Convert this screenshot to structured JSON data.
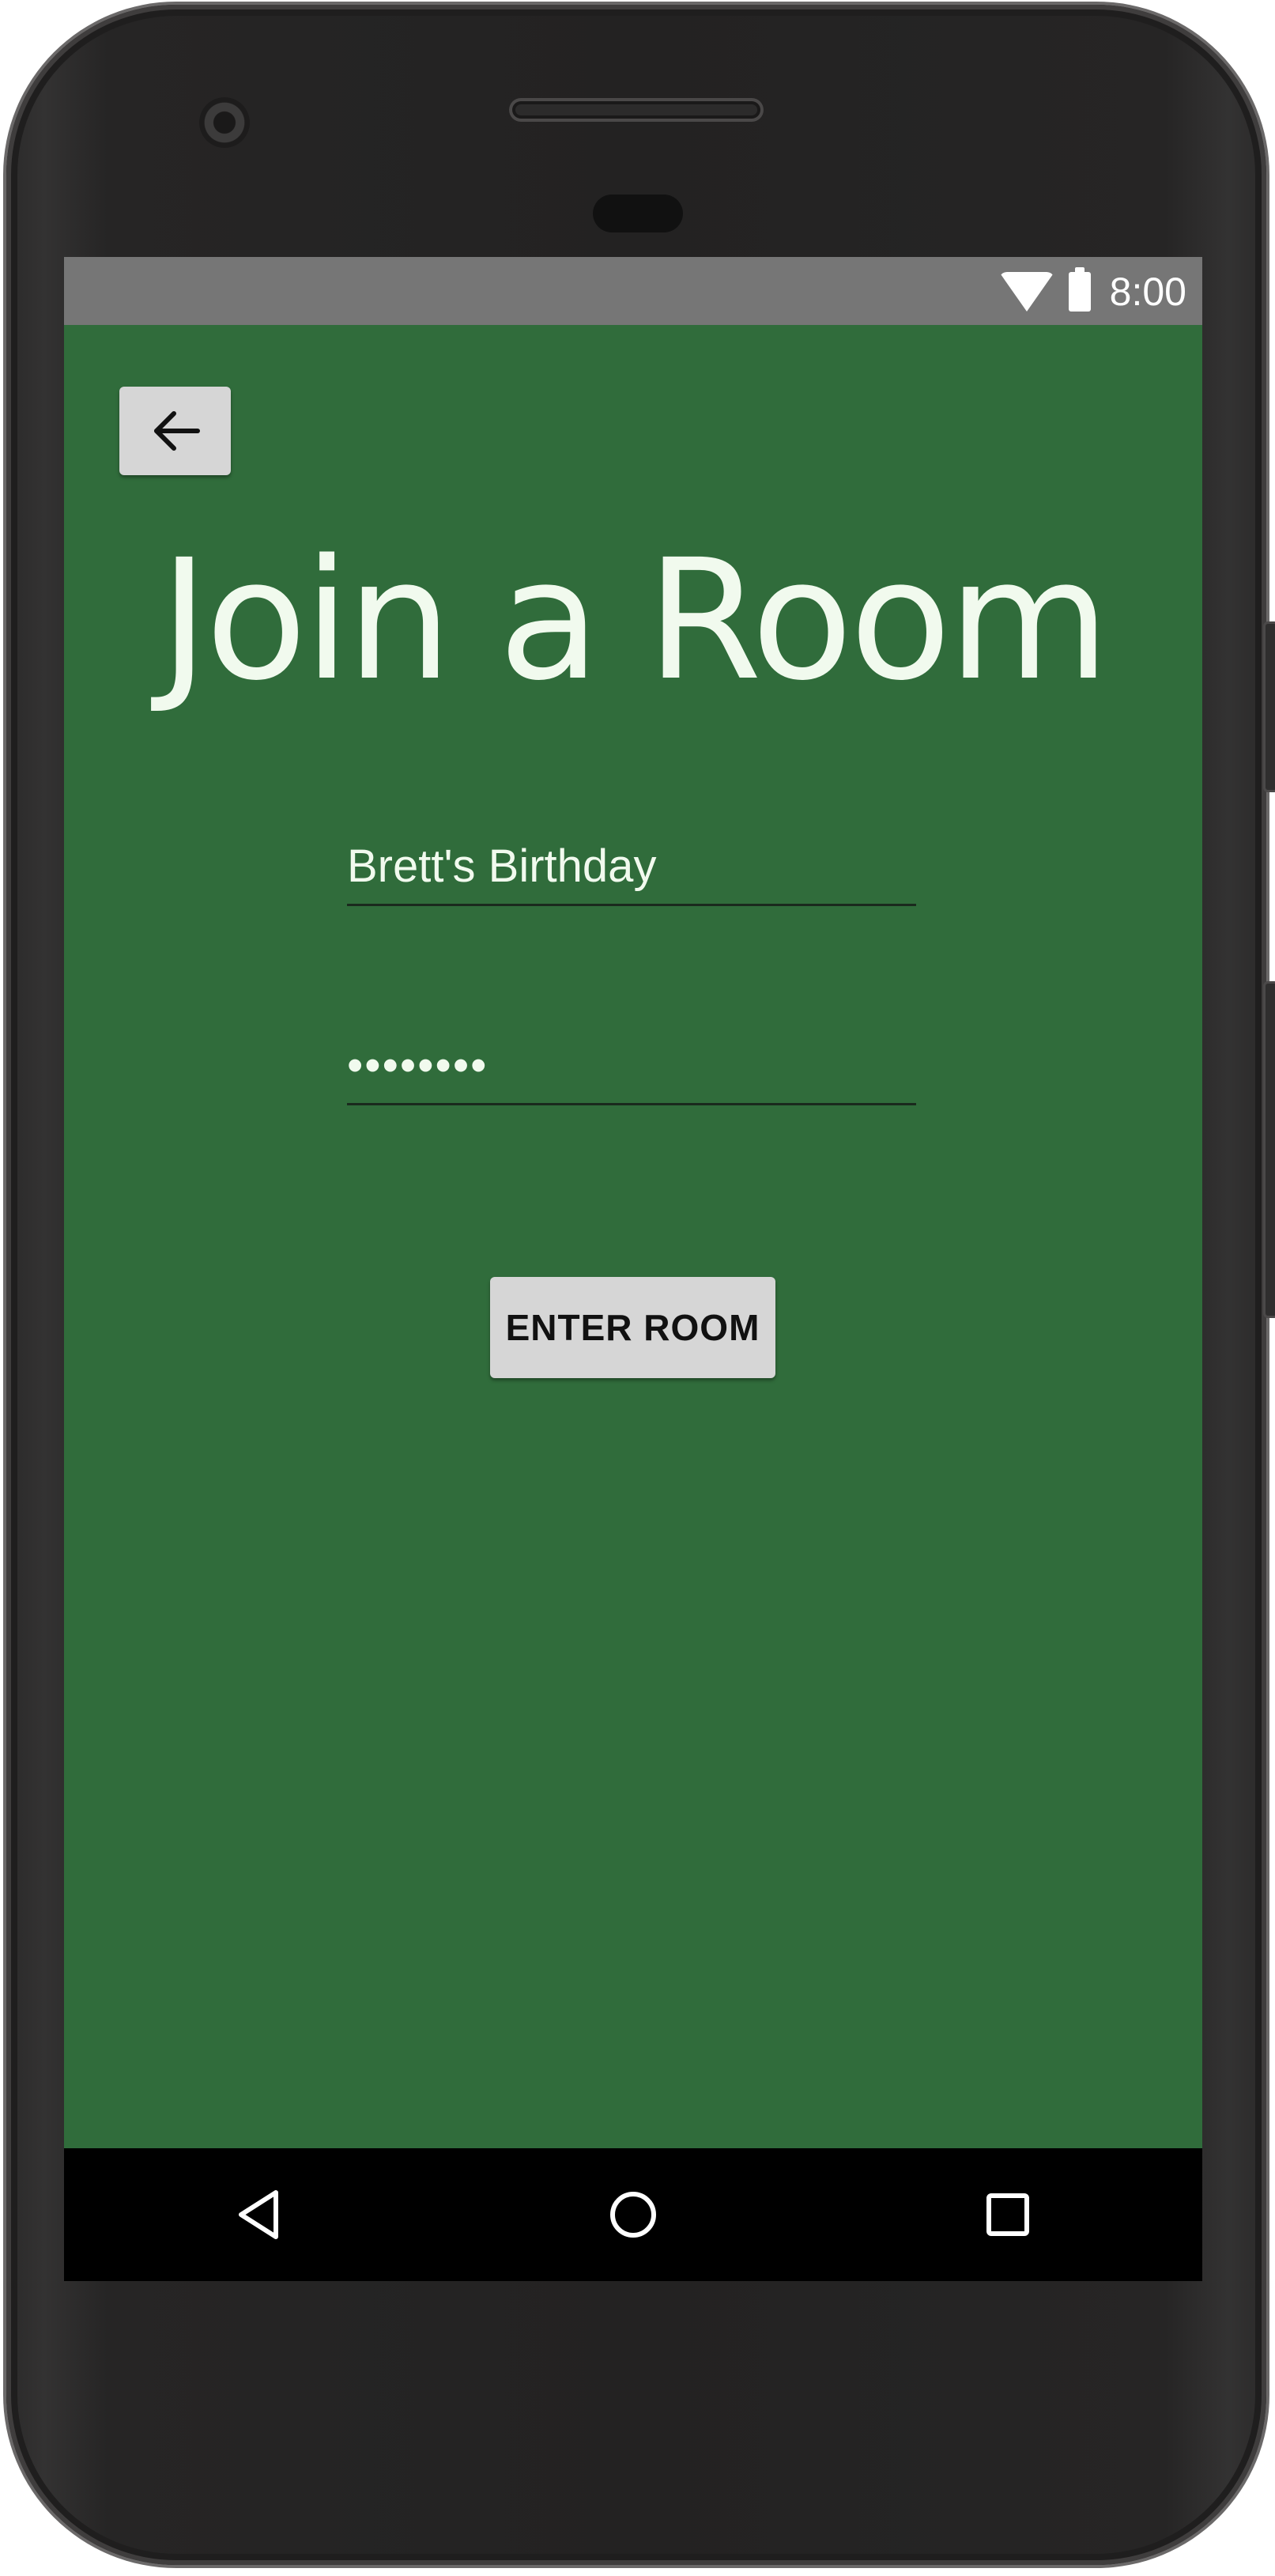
{
  "status_bar": {
    "time": "8:00",
    "icons": [
      "wifi-icon",
      "battery-icon"
    ]
  },
  "toolbar": {
    "back_icon": "arrow-left-icon"
  },
  "page": {
    "title": "Join a Room"
  },
  "form": {
    "room_name_value": "Brett's Birthday",
    "password_value": "password",
    "enter_label": "ENTER ROOM"
  },
  "navigation": {
    "icons": [
      "nav-back-icon",
      "nav-home-icon",
      "nav-recents-icon"
    ]
  },
  "colors": {
    "screen_background": "#306c3b",
    "status_bar": "#767676",
    "title_text": "#f1faee",
    "button_background": "#d6d6d6"
  }
}
